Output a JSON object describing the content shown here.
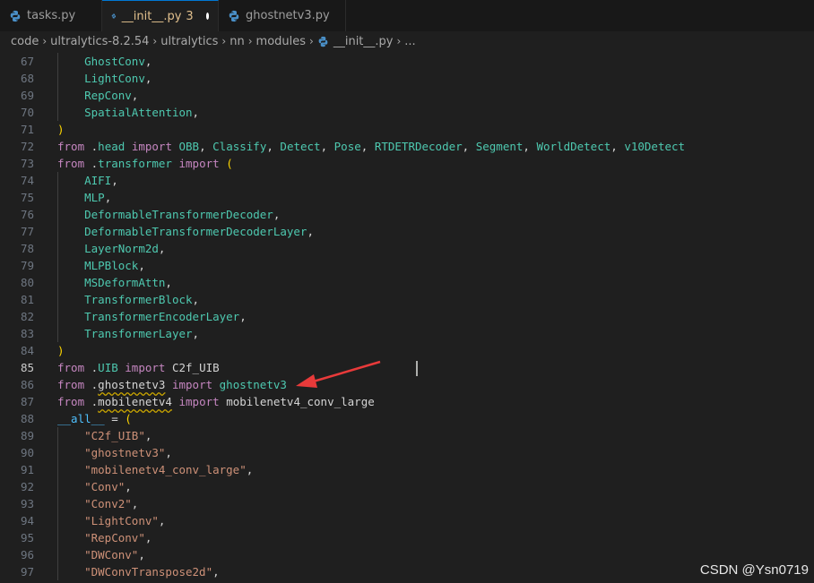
{
  "tabs": [
    {
      "label": "tasks.py",
      "active": false,
      "icon": "python-icon"
    },
    {
      "label": "__init__.py",
      "badge": "3",
      "active": true,
      "modified": true,
      "icon": "python-icon"
    },
    {
      "label": "ghostnetv3.py",
      "active": false,
      "icon": "python-icon"
    }
  ],
  "breadcrumb": [
    "code",
    "ultralytics-8.2.54",
    "ultralytics",
    "nn",
    "modules",
    "__init__.py",
    "..."
  ],
  "colors": {
    "background": "#1f1f1f",
    "keyword": "#c586c0",
    "identifier": "#4ec9b0",
    "string": "#ce9178",
    "bracket": "#ffd700",
    "annotation_arrow": "#e83a3a"
  },
  "lines": [
    {
      "n": "67",
      "segs": [
        [
          "    ",
          "plain"
        ],
        [
          "GhostConv",
          "fn"
        ],
        [
          ",",
          "plain"
        ]
      ]
    },
    {
      "n": "68",
      "segs": [
        [
          "    ",
          "plain"
        ],
        [
          "LightConv",
          "fn"
        ],
        [
          ",",
          "plain"
        ]
      ]
    },
    {
      "n": "69",
      "segs": [
        [
          "    ",
          "plain"
        ],
        [
          "RepConv",
          "fn"
        ],
        [
          ",",
          "plain"
        ]
      ]
    },
    {
      "n": "70",
      "segs": [
        [
          "    ",
          "plain"
        ],
        [
          "SpatialAttention",
          "fn"
        ],
        [
          ",",
          "plain"
        ]
      ]
    },
    {
      "n": "71",
      "segs": [
        [
          ")",
          "br"
        ]
      ]
    },
    {
      "n": "72",
      "segs": [
        [
          "from",
          "kw"
        ],
        [
          " .",
          "plain"
        ],
        [
          "head",
          "mod"
        ],
        [
          " ",
          "plain"
        ],
        [
          "import",
          "kw"
        ],
        [
          " ",
          "plain"
        ],
        [
          "OBB",
          "fn"
        ],
        [
          ", ",
          "plain"
        ],
        [
          "Classify",
          "fn"
        ],
        [
          ", ",
          "plain"
        ],
        [
          "Detect",
          "fn"
        ],
        [
          ", ",
          "plain"
        ],
        [
          "Pose",
          "fn"
        ],
        [
          ", ",
          "plain"
        ],
        [
          "RTDETRDecoder",
          "fn"
        ],
        [
          ", ",
          "plain"
        ],
        [
          "Segment",
          "fn"
        ],
        [
          ", ",
          "plain"
        ],
        [
          "WorldDetect",
          "fn"
        ],
        [
          ", ",
          "plain"
        ],
        [
          "v10Detect",
          "fn"
        ]
      ]
    },
    {
      "n": "73",
      "segs": [
        [
          "from",
          "kw"
        ],
        [
          " .",
          "plain"
        ],
        [
          "transformer",
          "mod"
        ],
        [
          " ",
          "plain"
        ],
        [
          "import",
          "kw"
        ],
        [
          " ",
          "plain"
        ],
        [
          "(",
          "br"
        ]
      ]
    },
    {
      "n": "74",
      "segs": [
        [
          "    ",
          "plain"
        ],
        [
          "AIFI",
          "fn"
        ],
        [
          ",",
          "plain"
        ]
      ]
    },
    {
      "n": "75",
      "segs": [
        [
          "    ",
          "plain"
        ],
        [
          "MLP",
          "fn"
        ],
        [
          ",",
          "plain"
        ]
      ]
    },
    {
      "n": "76",
      "segs": [
        [
          "    ",
          "plain"
        ],
        [
          "DeformableTransformerDecoder",
          "fn"
        ],
        [
          ",",
          "plain"
        ]
      ]
    },
    {
      "n": "77",
      "segs": [
        [
          "    ",
          "plain"
        ],
        [
          "DeformableTransformerDecoderLayer",
          "fn"
        ],
        [
          ",",
          "plain"
        ]
      ]
    },
    {
      "n": "78",
      "segs": [
        [
          "    ",
          "plain"
        ],
        [
          "LayerNorm2d",
          "fn"
        ],
        [
          ",",
          "plain"
        ]
      ]
    },
    {
      "n": "79",
      "segs": [
        [
          "    ",
          "plain"
        ],
        [
          "MLPBlock",
          "fn"
        ],
        [
          ",",
          "plain"
        ]
      ]
    },
    {
      "n": "80",
      "segs": [
        [
          "    ",
          "plain"
        ],
        [
          "MSDeformAttn",
          "fn"
        ],
        [
          ",",
          "plain"
        ]
      ]
    },
    {
      "n": "81",
      "segs": [
        [
          "    ",
          "plain"
        ],
        [
          "TransformerBlock",
          "fn"
        ],
        [
          ",",
          "plain"
        ]
      ]
    },
    {
      "n": "82",
      "segs": [
        [
          "    ",
          "plain"
        ],
        [
          "TransformerEncoderLayer",
          "fn"
        ],
        [
          ",",
          "plain"
        ]
      ]
    },
    {
      "n": "83",
      "segs": [
        [
          "    ",
          "plain"
        ],
        [
          "TransformerLayer",
          "fn"
        ],
        [
          ",",
          "plain"
        ]
      ]
    },
    {
      "n": "84",
      "segs": [
        [
          ")",
          "br"
        ]
      ]
    },
    {
      "n": "85",
      "current": true,
      "segs": [
        [
          "from",
          "kw"
        ],
        [
          " .",
          "plain"
        ],
        [
          "UIB",
          "mod"
        ],
        [
          " ",
          "plain"
        ],
        [
          "import",
          "kw"
        ],
        [
          " ",
          "plain"
        ],
        [
          "C2f_UIB",
          "plain"
        ]
      ]
    },
    {
      "n": "86",
      "segs": [
        [
          "from",
          "kw"
        ],
        [
          " .",
          "plain"
        ],
        [
          "ghostnetv3",
          "plain squig"
        ],
        [
          " ",
          "plain"
        ],
        [
          "import",
          "kw"
        ],
        [
          " ",
          "plain"
        ],
        [
          "ghostnetv3",
          "fn"
        ]
      ]
    },
    {
      "n": "87",
      "segs": [
        [
          "from",
          "kw"
        ],
        [
          " .",
          "plain"
        ],
        [
          "mobilenetv4",
          "plain squig"
        ],
        [
          " ",
          "plain"
        ],
        [
          "import",
          "kw"
        ],
        [
          " ",
          "plain"
        ],
        [
          "mobilenetv4_conv_large",
          "plain"
        ]
      ]
    },
    {
      "n": "88",
      "segs": [
        [
          "__all__",
          "var"
        ],
        [
          " = ",
          "plain"
        ],
        [
          "(",
          "br"
        ]
      ]
    },
    {
      "n": "89",
      "segs": [
        [
          "    ",
          "plain"
        ],
        [
          "\"C2f_UIB\"",
          "str"
        ],
        [
          ",",
          "plain"
        ]
      ]
    },
    {
      "n": "90",
      "segs": [
        [
          "    ",
          "plain"
        ],
        [
          "\"ghostnetv3\"",
          "str"
        ],
        [
          ",",
          "plain"
        ]
      ]
    },
    {
      "n": "91",
      "segs": [
        [
          "    ",
          "plain"
        ],
        [
          "\"mobilenetv4_conv_large\"",
          "str"
        ],
        [
          ",",
          "plain"
        ]
      ]
    },
    {
      "n": "92",
      "segs": [
        [
          "    ",
          "plain"
        ],
        [
          "\"Conv\"",
          "str"
        ],
        [
          ",",
          "plain"
        ]
      ]
    },
    {
      "n": "93",
      "segs": [
        [
          "    ",
          "plain"
        ],
        [
          "\"Conv2\"",
          "str"
        ],
        [
          ",",
          "plain"
        ]
      ]
    },
    {
      "n": "94",
      "segs": [
        [
          "    ",
          "plain"
        ],
        [
          "\"LightConv\"",
          "str"
        ],
        [
          ",",
          "plain"
        ]
      ]
    },
    {
      "n": "95",
      "segs": [
        [
          "    ",
          "plain"
        ],
        [
          "\"RepConv\"",
          "str"
        ],
        [
          ",",
          "plain"
        ]
      ]
    },
    {
      "n": "96",
      "segs": [
        [
          "    ",
          "plain"
        ],
        [
          "\"DWConv\"",
          "str"
        ],
        [
          ",",
          "plain"
        ]
      ]
    },
    {
      "n": "97",
      "segs": [
        [
          "    ",
          "plain"
        ],
        [
          "\"DWConvTranspose2d\"",
          "str"
        ],
        [
          ",",
          "plain"
        ]
      ]
    }
  ],
  "watermark": "CSDN @Ysn0719"
}
